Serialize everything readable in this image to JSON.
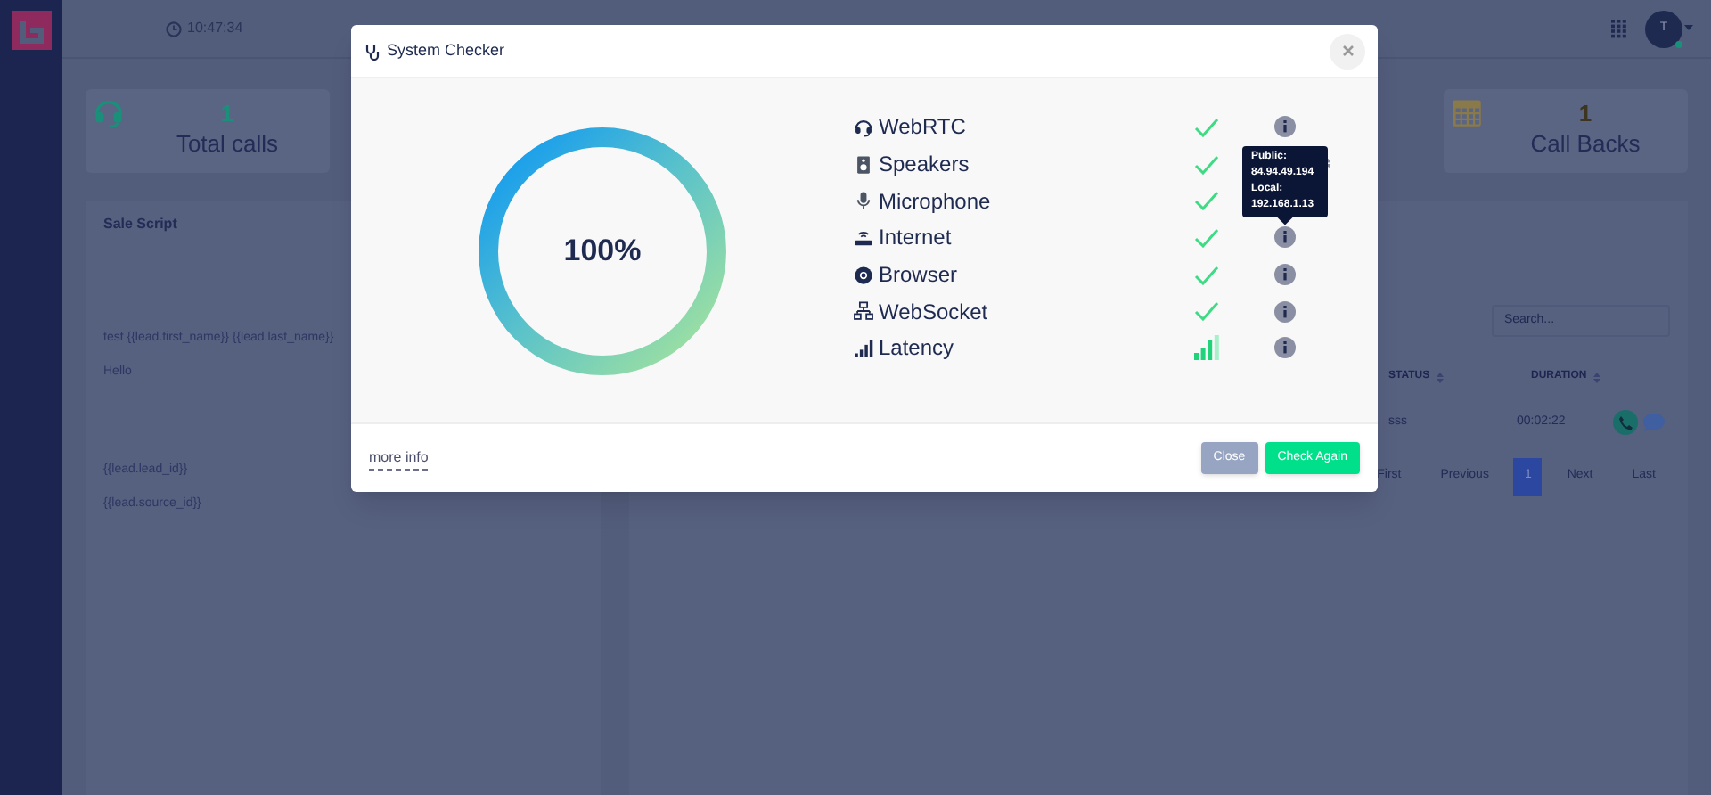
{
  "header": {
    "time": "10:47:34",
    "user_initial": "T"
  },
  "stats": [
    {
      "value": "1",
      "label": "Total calls"
    },
    {
      "value": "1",
      "label": "Call Backs"
    }
  ],
  "script": {
    "title": "Sale Script",
    "paragraphs": [
      [
        "test {{lead.first_name}} {{lead.last_name}}",
        "Hello"
      ],
      [
        "{{lead.lead_id}}",
        "{{lead.source_id}}"
      ]
    ]
  },
  "calls": {
    "search": {
      "placeholder": "Search..."
    },
    "columns": [
      "STATUS",
      "DURATION"
    ],
    "rows": [
      {
        "status": "sss",
        "duration": "00:02:22"
      }
    ],
    "pagination": [
      {
        "label": "First",
        "selected": false
      },
      {
        "label": "Previous",
        "selected": false
      },
      {
        "label": "1",
        "selected": true
      },
      {
        "label": "Next",
        "selected": false
      },
      {
        "label": "Last",
        "selected": false
      }
    ]
  },
  "dialog": {
    "title": "System Checker",
    "score": "100%",
    "level": 1,
    "checks": [
      {
        "name": "WebRTC",
        "kind": "check",
        "settings": false
      },
      {
        "name": "Speakers",
        "kind": "check",
        "settings": true
      },
      {
        "name": "Microphone",
        "kind": "check",
        "settings": false
      },
      {
        "name": "Internet",
        "kind": "check",
        "settings": false,
        "tooltip": [
          "Public:",
          "84.94.49.194",
          "Local:",
          "192.168.1.13"
        ]
      },
      {
        "name": "Browser",
        "kind": "check",
        "settings": false
      },
      {
        "name": "WebSocket",
        "kind": "check",
        "settings": false
      },
      {
        "name": "Latency",
        "kind": "signal",
        "settings": false
      }
    ],
    "more_info": "more info",
    "buttons": [
      {
        "label": "Close",
        "kind": "secondary"
      },
      {
        "label": "Check Again",
        "kind": "primary"
      }
    ]
  }
}
